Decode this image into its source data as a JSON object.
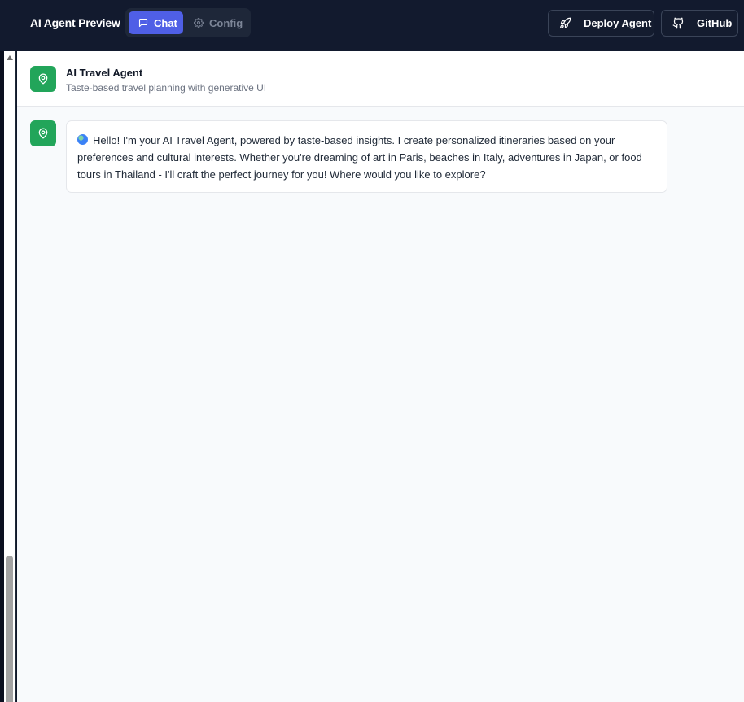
{
  "topbar": {
    "title": "AI Agent Preview",
    "tabs": [
      {
        "label": "Chat",
        "icon": "chat-bubble-icon",
        "active": true
      },
      {
        "label": "Config",
        "icon": "gear-icon",
        "active": false
      }
    ],
    "deploy_label": "Deploy Agent",
    "github_label": "GitHub"
  },
  "agent": {
    "name": "AI Travel Agent",
    "subtitle": "Taste-based travel planning with generative UI",
    "icon": "map-pin-icon"
  },
  "messages": [
    {
      "role": "agent",
      "emoji": "globe",
      "text": "Hello! I'm your AI Travel Agent, powered by taste-based insights. I create personalized itineraries based on your preferences and cultural interests. Whether you're dreaming of art in Paris, beaches in Italy, adventures in Japan, or food tours in Thailand - I'll craft the perfect journey for you! Where would you like to explore?"
    }
  ],
  "colors": {
    "topbar_bg": "#121a2e",
    "accent": "#4f5fe6",
    "agent_green": "#22a55a",
    "chat_bg": "#f8fafc"
  }
}
